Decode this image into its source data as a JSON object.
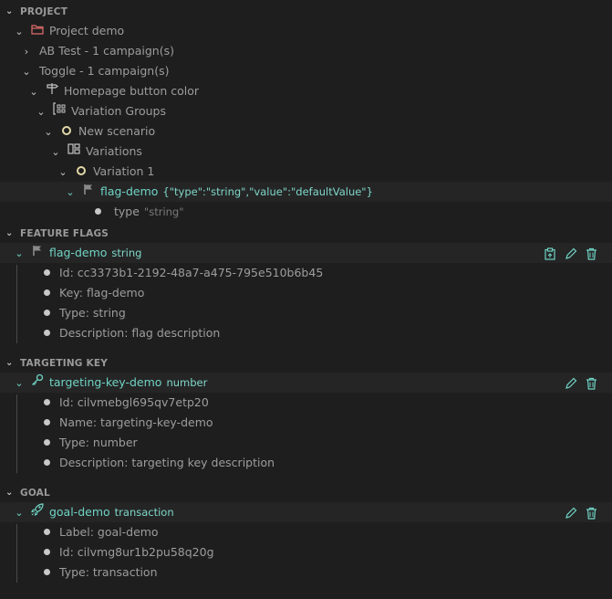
{
  "sections": {
    "project": "PROJECT",
    "feature_flags": "FEATURE FLAGS",
    "targeting_key": "TARGETING KEY",
    "goal": "GOAL"
  },
  "project_tree": {
    "project": "Project demo",
    "ab_test": "AB Test - 1 campaign(s)",
    "toggle": "Toggle - 1 campaign(s)",
    "campaign": "Homepage button color",
    "variation_groups": "Variation Groups",
    "scenario": "New scenario",
    "variations": "Variations",
    "variation": "Variation 1",
    "flag": "flag-demo",
    "flag_value": "{\"type\":\"string\",\"value\":\"defaultValue\"}",
    "type_label": "type",
    "type_value": "\"string\""
  },
  "feature_flag": {
    "name": "flag-demo",
    "type": "string",
    "details": [
      "Id: cc3373b1-2192-48a7-a475-795e510b6b45",
      "Key: flag-demo",
      "Type: string",
      "Description: flag description"
    ]
  },
  "targeting_key": {
    "name": "targeting-key-demo",
    "type": "number",
    "details": [
      "Id: cilvmebgl695qv7etp20",
      "Name: targeting-key-demo",
      "Type: number",
      "Description: targeting key description"
    ]
  },
  "goal": {
    "name": "goal-demo",
    "type": "transaction",
    "details": [
      "Label: goal-demo",
      "Id: cilvmg8ur1b2pu58q20g",
      "Type: transaction"
    ]
  },
  "colors": {
    "background": "#1e1e1e",
    "accent": "#6fd3c3",
    "project_icon": "#e06c6c",
    "scenario_ring": "#e2d8a8"
  },
  "icons": [
    "chevron-down-icon",
    "chevron-right-icon",
    "folder-icon",
    "signpost-icon",
    "variation-groups-icon",
    "variations-icon",
    "flag-icon",
    "key-icon",
    "rocket-icon",
    "clipboard-icon",
    "pencil-icon",
    "trash-icon"
  ]
}
